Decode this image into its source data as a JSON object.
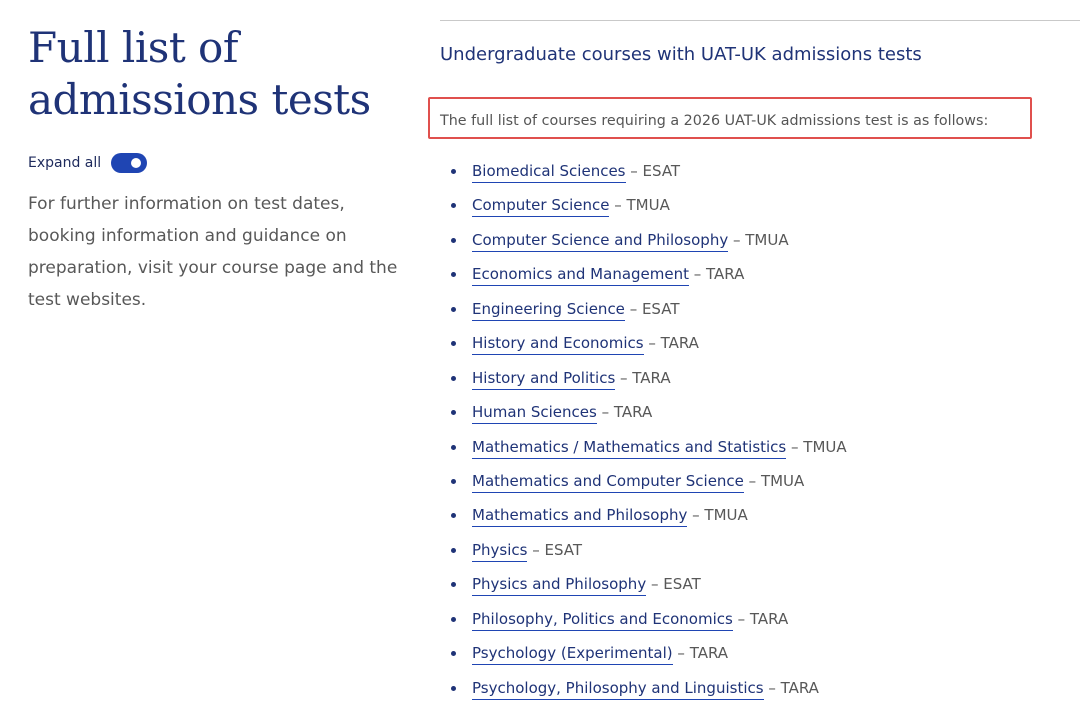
{
  "left": {
    "title_line1": "Full list of",
    "title_line2": "admissions tests",
    "expand_label": "Expand all",
    "intro_text": "For further information on test dates, booking information and guidance on preparation, visit your course page and the test websites."
  },
  "main": {
    "heading": "Undergraduate courses with UAT-UK admissions tests",
    "intro_line": "The full list of courses requiring a 2026 UAT-UK admissions test is as follows:",
    "courses": [
      {
        "name": "Biomedical Sciences",
        "test": " – ESAT"
      },
      {
        "name": "Computer Science",
        "test": " – TMUA"
      },
      {
        "name": "Computer Science and Philosophy",
        "test": " – TMUA"
      },
      {
        "name": "Economics and Management",
        "test": " – TARA"
      },
      {
        "name": "Engineering Science",
        "test": " – ESAT"
      },
      {
        "name": "History and Economics",
        "test": " – TARA"
      },
      {
        "name": "History and Politics",
        "test": " – TARA"
      },
      {
        "name": "Human Sciences",
        "test": " – TARA"
      },
      {
        "name": "Mathematics / Mathematics and Statistics",
        "test": " – TMUA"
      },
      {
        "name": "Mathematics and Computer Science",
        "test": " – TMUA"
      },
      {
        "name": "Mathematics and Philosophy",
        "test": " – TMUA"
      },
      {
        "name": "Physics",
        "test": " – ESAT"
      },
      {
        "name": "Physics and Philosophy",
        "test": " – ESAT"
      },
      {
        "name": "Philosophy, Politics and Economics",
        "test": " – TARA"
      },
      {
        "name": "Psychology (Experimental)",
        "test": " – TARA"
      },
      {
        "name": "Psychology, Philosophy and Linguistics",
        "test": " – TARA"
      }
    ]
  },
  "colors": {
    "heading_blue": "#1f3377",
    "link_underline": "#1f45b3",
    "highlight_red": "#e0504d",
    "toggle_on": "#1f45b3"
  }
}
